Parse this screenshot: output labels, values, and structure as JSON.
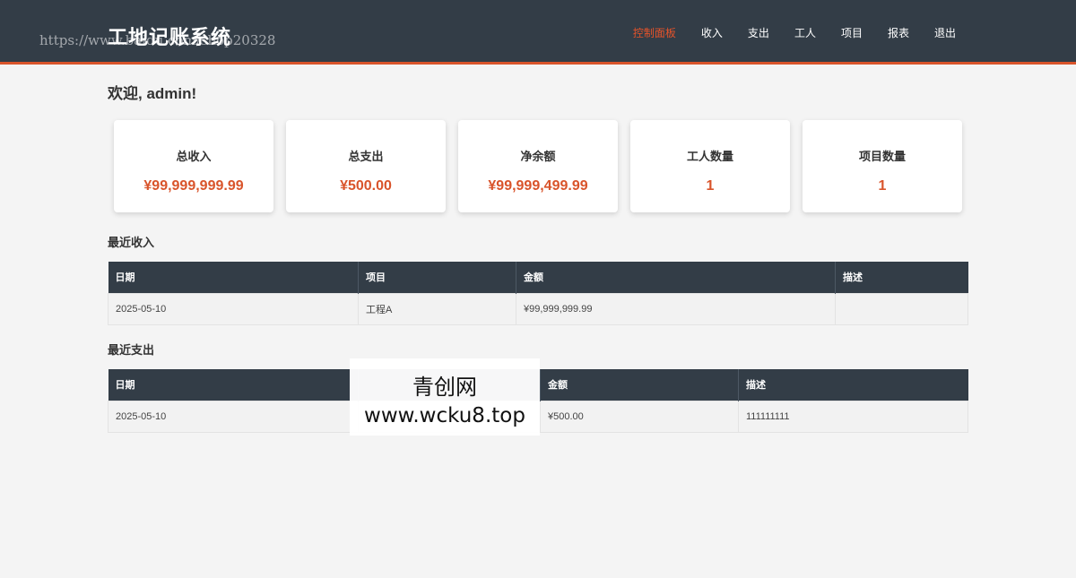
{
  "header": {
    "title": "工地记账系统",
    "watermark_url": "https://www.baidu.com/shop20328",
    "nav": [
      {
        "label": "控制面板",
        "active": true
      },
      {
        "label": "收入"
      },
      {
        "label": "支出"
      },
      {
        "label": "工人"
      },
      {
        "label": "项目"
      },
      {
        "label": "报表"
      },
      {
        "label": "退出"
      }
    ]
  },
  "welcome": "欢迎, admin!",
  "stats": [
    {
      "label": "总收入",
      "value": "¥99,999,999.99"
    },
    {
      "label": "总支出",
      "value": "¥500.00"
    },
    {
      "label": "净余额",
      "value": "¥99,999,499.99"
    },
    {
      "label": "工人数量",
      "value": "1"
    },
    {
      "label": "项目数量",
      "value": "1"
    }
  ],
  "recent_income": {
    "title": "最近收入",
    "headers": [
      "日期",
      "项目",
      "金额",
      "描述"
    ],
    "rows": [
      [
        "2025-05-10",
        "工程A",
        "¥99,999,999.99",
        ""
      ]
    ]
  },
  "recent_expense": {
    "title": "最近支出",
    "headers": [
      "日期",
      "",
      "金额",
      "描述"
    ],
    "rows": [
      [
        "2025-05-10",
        "",
        "¥500.00",
        "111111111"
      ]
    ]
  },
  "overlay": {
    "line1": "青创网",
    "line2": "www.wcku8.top"
  },
  "colors": {
    "header_bg": "#333d47",
    "accent": "#d9542b",
    "page_bg": "#f4f4f4"
  }
}
